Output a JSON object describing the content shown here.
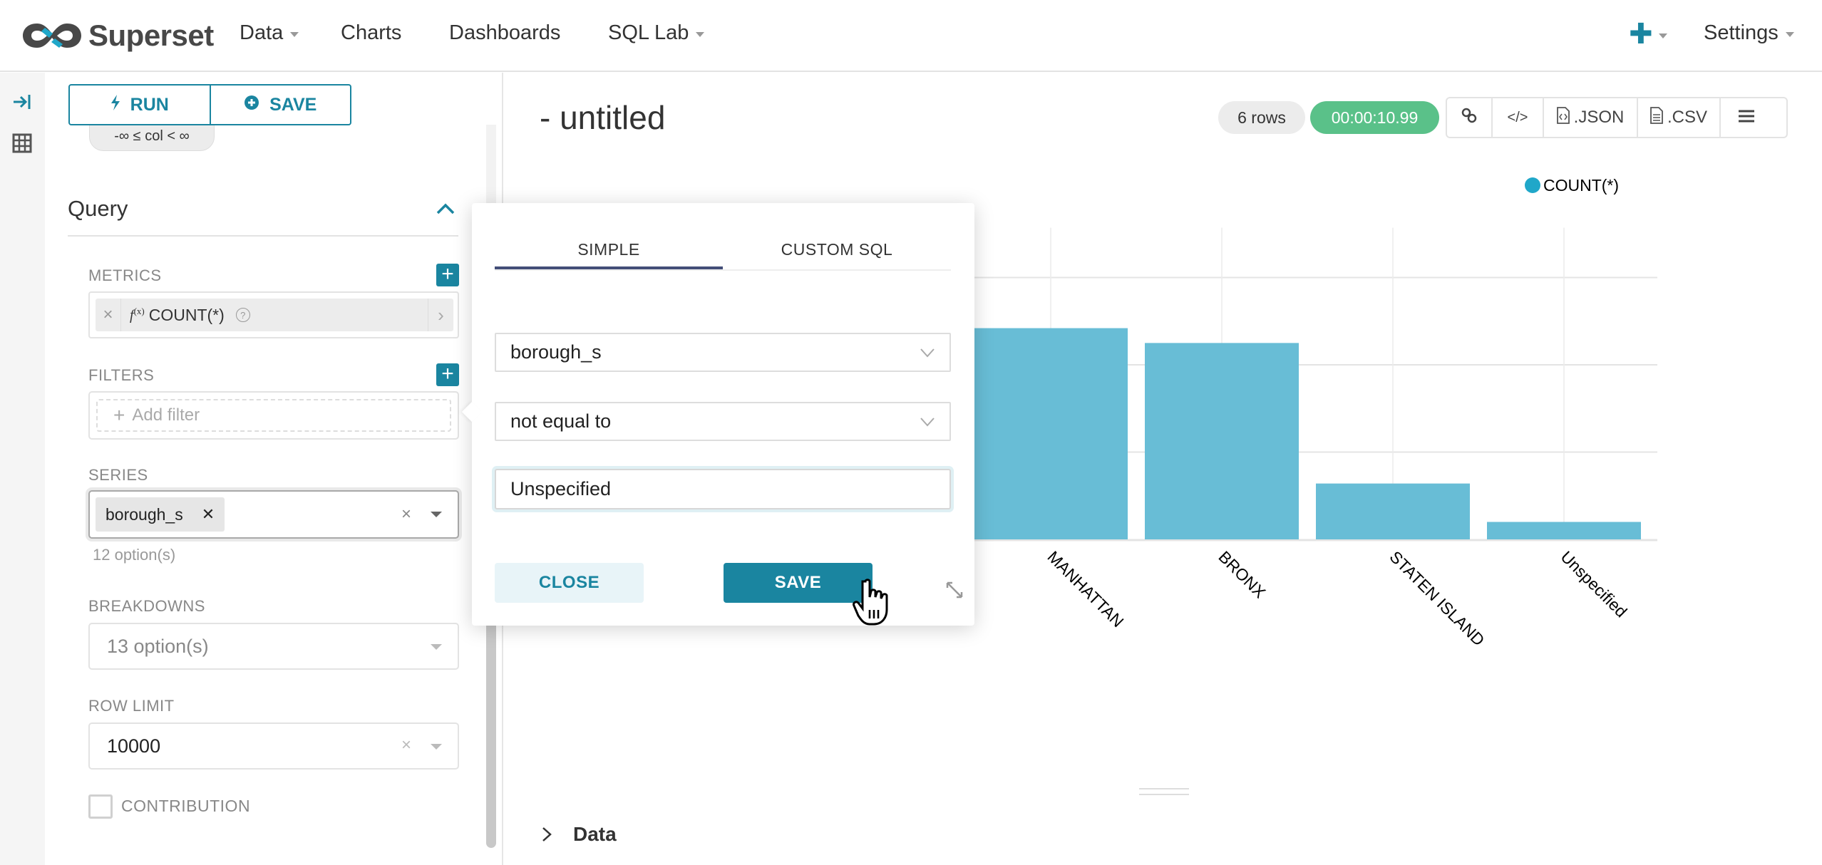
{
  "navbar": {
    "brand": "Superset",
    "items": [
      {
        "label": "Data",
        "has_caret": true
      },
      {
        "label": "Charts",
        "has_caret": false
      },
      {
        "label": "Dashboards",
        "has_caret": false
      },
      {
        "label": "SQL Lab",
        "has_caret": true
      }
    ],
    "new_icon": "plus-icon",
    "settings_label": "Settings",
    "accent_color": "#1a85a0"
  },
  "rail": {
    "collapse_icon": "collapse-right-icon",
    "datasource_icon": "table-grid-icon"
  },
  "panel": {
    "run_label": "RUN",
    "save_label": "SAVE",
    "range_pill": "-∞ ≤ col < ∞",
    "section_title": "Query",
    "metrics": {
      "label": "METRICS",
      "items": [
        {
          "fx": "f",
          "fx_sup": "(x)",
          "name": "COUNT(*)"
        }
      ]
    },
    "filters": {
      "label": "FILTERS",
      "add_placeholder": "Add filter"
    },
    "series": {
      "label": "SERIES",
      "selected": "borough_s",
      "hint": "12 option(s)"
    },
    "breakdowns": {
      "label": "BREAKDOWNS",
      "placeholder": "13 option(s)"
    },
    "row_limit": {
      "label": "ROW LIMIT",
      "value": "10000"
    },
    "contribution": {
      "label": "CONTRIBUTION",
      "checked": false
    }
  },
  "main": {
    "title": "- untitled",
    "row_count": "6 rows",
    "timer": "00:00:10.99",
    "timer_color": "#5ac189",
    "toolbar": {
      "link_icon": "link-icon",
      "embed_icon": "code-icon",
      "json_label": ".JSON",
      "csv_label": ".CSV",
      "menu_icon": "hamburger-icon"
    },
    "data_panel_label": "Data"
  },
  "popover": {
    "tabs": [
      {
        "label": "SIMPLE",
        "active": true
      },
      {
        "label": "CUSTOM SQL",
        "active": false
      }
    ],
    "column": "borough_s",
    "operator": "not equal to",
    "value": "Unspecified",
    "close_label": "CLOSE",
    "save_label": "SAVE"
  },
  "chart_data": {
    "type": "bar",
    "title": "",
    "xlabel": "",
    "ylabel": "",
    "legend": {
      "entries": [
        "COUNT(*)"
      ],
      "position": "top-right"
    },
    "series": [
      {
        "name": "COUNT(*)",
        "color": "#68bdd6",
        "legend_color": "#20a7c9"
      }
    ],
    "categories": [
      "MANHATTAN",
      "BRONX",
      "STATEN ISLAND",
      "Unspecified"
    ],
    "values": [
      2.42,
      2.25,
      0.64,
      0.2
    ],
    "value_units": "gridline intervals (y tick labels hidden behind popover)",
    "ylim": [
      0,
      3.8
    ],
    "gridlines": [
      1,
      2,
      3
    ],
    "grid": true,
    "x_label_rotation_deg": 45,
    "note": "6 rows total; first two bars are covered by the filter popover"
  }
}
